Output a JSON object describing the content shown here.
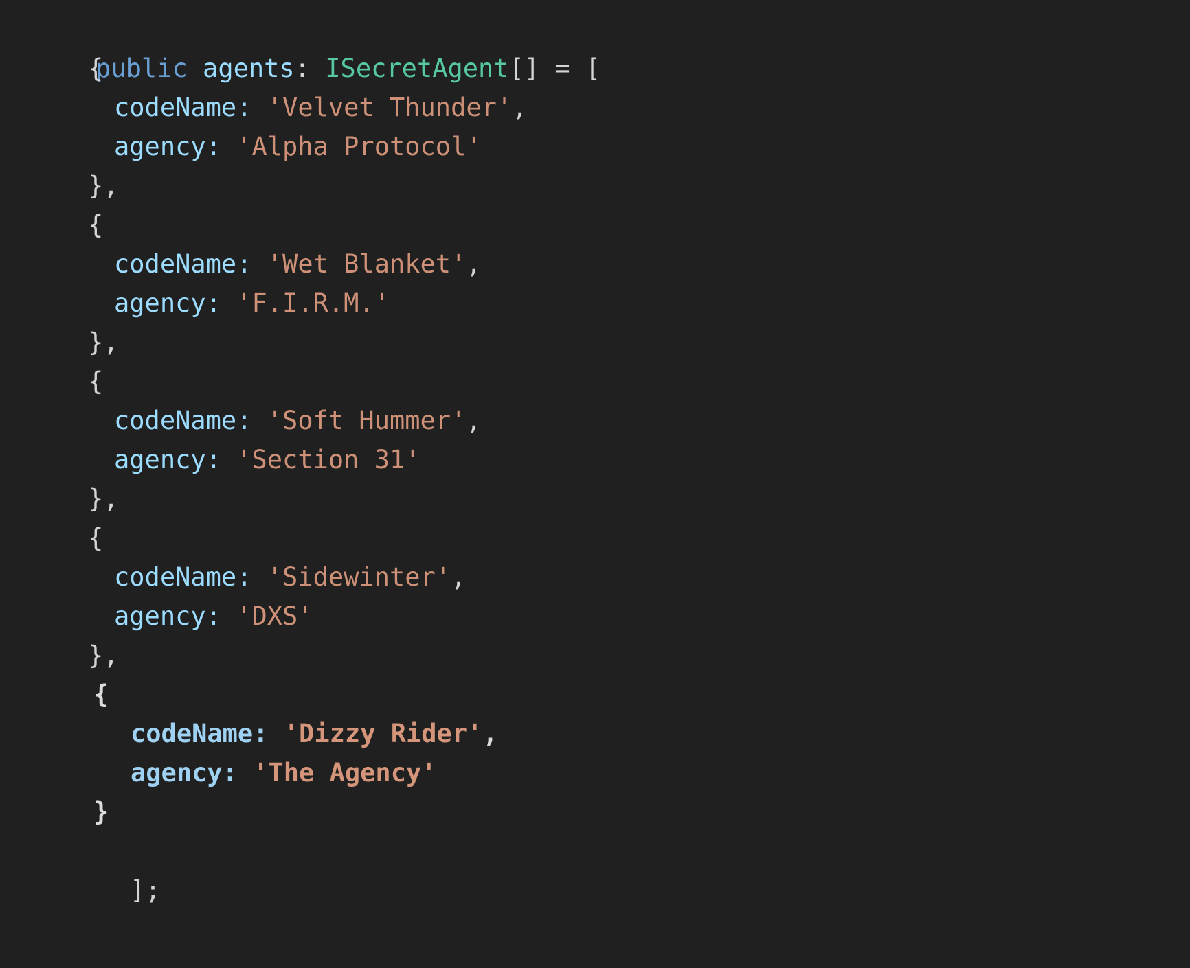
{
  "editor": {
    "language": "typescript",
    "background_color": "#202020",
    "theme": "dark",
    "colors": {
      "keyword": "#6a9fd4",
      "variable": "#9cdcfe",
      "type": "#56c9a0",
      "property": "#9cdcfe",
      "string": "#ce9178",
      "punctuation": "#d4d4d4"
    }
  },
  "code": {
    "declaration": {
      "keyword": "public",
      "space1": " ",
      "variable": "agents",
      "colon": ": ",
      "type": "ISecretAgent",
      "array_brackets": "[]",
      "equals": " = ",
      "open_bracket": "["
    },
    "property_labels": {
      "code_name": "codeName:",
      "agency": "agency:"
    },
    "punctuation": {
      "open_brace": "{",
      "close_brace_comma": "},",
      "close_brace": "}",
      "close_array": "];",
      "comma": ",",
      "quote": "'"
    },
    "agents": [
      {
        "codeName": "Velvet Thunder",
        "agency": "Alpha Protocol",
        "trailing_comma": true,
        "highlighted": false
      },
      {
        "codeName": "Wet Blanket",
        "agency": "F.I.R.M.",
        "trailing_comma": true,
        "highlighted": false
      },
      {
        "codeName": "Soft Hummer",
        "agency": "Section 31",
        "trailing_comma": true,
        "highlighted": false
      },
      {
        "codeName": "Sidewinter",
        "agency": "DXS",
        "trailing_comma": true,
        "highlighted": false
      },
      {
        "codeName": "Dizzy Rider",
        "agency": "The Agency",
        "trailing_comma": false,
        "highlighted": true
      }
    ]
  }
}
